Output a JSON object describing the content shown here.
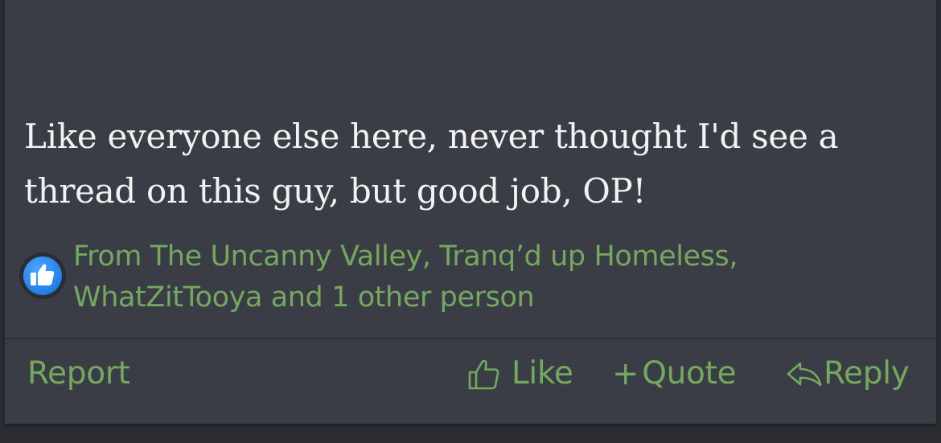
{
  "post": {
    "body_line1": "Like everyone else here, never thought I'd see a",
    "body_line2": "thread on this guy, but good job, OP!"
  },
  "reactions": {
    "icon": "thumbs-up-icon",
    "line1": "From The Uncanny Valley, Tranq’d up Homeless,",
    "line2": "WhatZitTooya and 1 other person"
  },
  "actions": {
    "report_label": "Report",
    "like_label": "Like",
    "quote_plus": "+",
    "quote_label": "Quote",
    "reply_label": "Reply"
  },
  "colors": {
    "background": "#3a3d45",
    "text": "#f2f2f2",
    "link_green": "#74a85e",
    "reaction_blue": "#2e8ff0"
  }
}
